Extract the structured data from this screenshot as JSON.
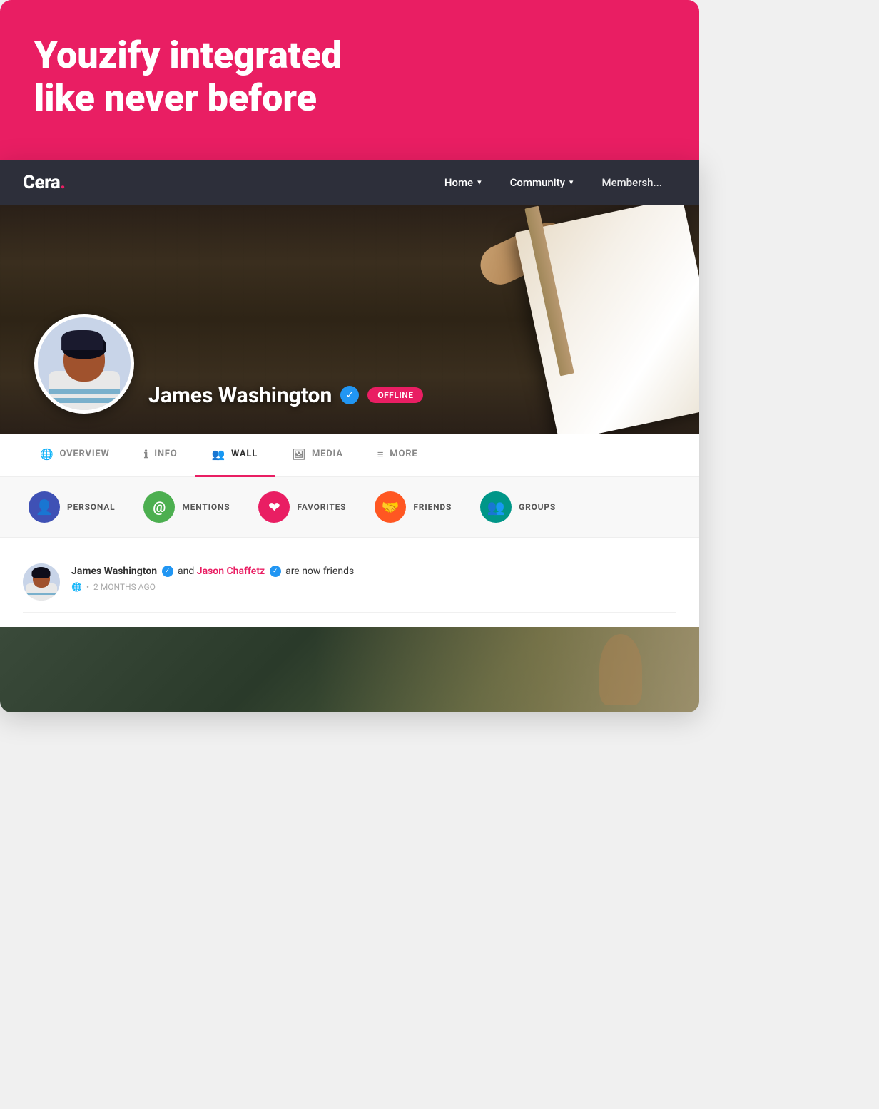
{
  "hero": {
    "title_line1": "Youzify integrated",
    "title_line2": "like never before"
  },
  "navbar": {
    "logo": "Cera",
    "logo_dot": ".",
    "links": [
      {
        "label": "Home",
        "has_dropdown": true
      },
      {
        "label": "Community",
        "has_dropdown": true
      },
      {
        "label": "Membersh..."
      }
    ]
  },
  "profile": {
    "name": "James Washington",
    "verified": true,
    "status": "OFFLINE",
    "tabs": [
      {
        "label": "OVERVIEW",
        "icon": "🌐",
        "active": false
      },
      {
        "label": "INFO",
        "icon": "ℹ",
        "active": false
      },
      {
        "label": "WALL",
        "icon": "👥",
        "active": true
      },
      {
        "label": "MEDIA",
        "icon": "🖼",
        "active": false
      },
      {
        "label": "MORE",
        "icon": "≡",
        "active": false
      }
    ]
  },
  "filters": [
    {
      "label": "PERSONAL",
      "color": "#3f51b5",
      "icon": "👤"
    },
    {
      "label": "MENTIONS",
      "color": "#4caf50",
      "icon": "@"
    },
    {
      "label": "FAVORITES",
      "color": "#e91e63",
      "icon": "❤"
    },
    {
      "label": "FRIENDS",
      "color": "#ff5722",
      "icon": "🤝"
    },
    {
      "label": "GROUPS",
      "color": "#009688",
      "icon": "👥"
    }
  ],
  "activity": [
    {
      "user": "James Washington",
      "user_verified": true,
      "conjunction": "and",
      "friend": "Jason Chaffetz",
      "friend_verified": true,
      "action": "are now friends",
      "time": "2 MONTHS AGO",
      "globe": true
    }
  ]
}
